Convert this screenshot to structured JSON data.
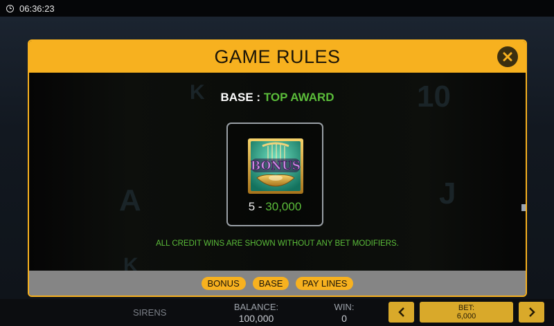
{
  "status_bar": {
    "time": "06:36:23",
    "icon": "clock-icon"
  },
  "modal": {
    "title": "GAME RULES",
    "close_icon": "close-icon",
    "section": {
      "base_label": "BASE :",
      "award_label": "TOP AWARD"
    },
    "symbol": {
      "text": "BONUS",
      "pay_count": "5 - ",
      "pay_value": "30,000"
    },
    "note": "ALL CREDIT WINS ARE SHOWN WITHOUT ANY BET MODIFIERS.",
    "tabs": [
      "BONUS",
      "BASE",
      "PAY LINES"
    ]
  },
  "hud": {
    "game_name": "SIRENS",
    "balance_label": "BALANCE:",
    "balance_value": "100,000",
    "win_label": "WIN:",
    "win_value": "0",
    "bet_label": "BET:",
    "bet_value": "6,000",
    "prev_icon": "chevron-left-icon",
    "next_icon": "chevron-right-icon"
  },
  "colors": {
    "accent": "#f7b11f",
    "win_green": "#5bbd3a",
    "footer_gray": "#858585"
  }
}
